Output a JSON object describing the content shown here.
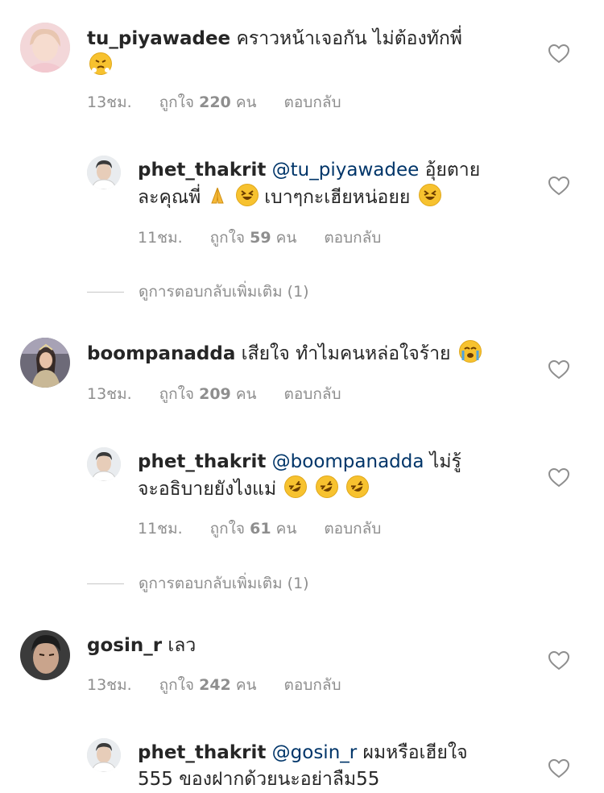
{
  "comments": [
    {
      "username": "tu_piyawadee",
      "text": "คราวหน้าเจอกัน ไม่ต้องทักพี่",
      "time": "13ชม.",
      "likes_prefix": "ถูกใจ",
      "likes": "220",
      "likes_suffix": "คน",
      "reply": "ตอบกลับ"
    },
    {
      "username": "phet_thakrit",
      "mention": "@tu_piyawadee",
      "text": "อุ้ยตาย",
      "text2": "ละคุณพี่",
      "text3": "เบาๆกะเฮียหน่อยย",
      "time": "11ชม.",
      "likes_prefix": "ถูกใจ",
      "likes": "59",
      "likes_suffix": "คน",
      "reply": "ตอบกลับ"
    },
    {
      "username": "boompanadda",
      "text": "เสียใจ ทำไมคนหล่อใจร้าย",
      "time": "13ชม.",
      "likes_prefix": "ถูกใจ",
      "likes": "209",
      "likes_suffix": "คน",
      "reply": "ตอบกลับ"
    },
    {
      "username": "phet_thakrit",
      "mention": "@boompanadda",
      "text": "ไม่รู้",
      "text2": "จะอธิบายยังไงแม่",
      "time": "11ชม.",
      "likes_prefix": "ถูกใจ",
      "likes": "61",
      "likes_suffix": "คน",
      "reply": "ตอบกลับ"
    },
    {
      "username": "gosin_r",
      "text": "เลว",
      "time": "13ชม.",
      "likes_prefix": "ถูกใจ",
      "likes": "242",
      "likes_suffix": "คน",
      "reply": "ตอบกลับ"
    },
    {
      "username": "phet_thakrit",
      "mention": "@gosin_r",
      "text": "ผมหรือเฮียใจ",
      "text2": "555 ของฝากด้วยนะอย่าลืม55"
    }
  ],
  "view_more_1": "ดูการตอบกลับเพิ่มเติม (1)",
  "view_more_2": "ดูการตอบกลับเพิ่มเติม (1)",
  "colors": {
    "link": "#003569",
    "muted": "#8e8e8e",
    "text": "#262626"
  },
  "icons": [
    "heart-icon"
  ]
}
